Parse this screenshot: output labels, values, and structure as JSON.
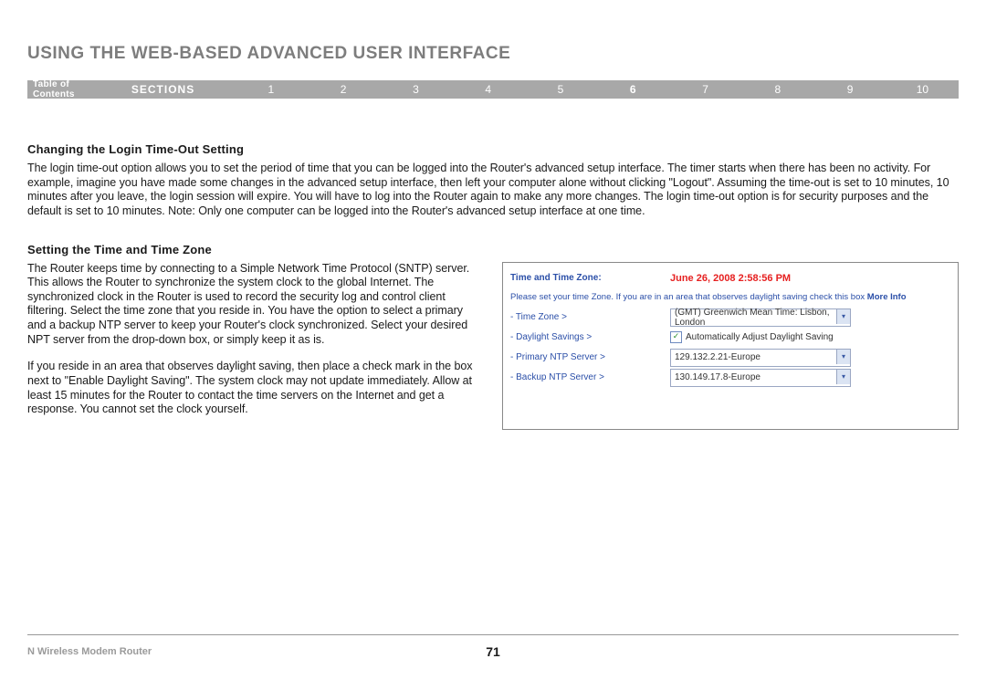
{
  "header": {
    "title": "USING THE WEB-BASED ADVANCED USER INTERFACE"
  },
  "nav": {
    "toc": "Table of Contents",
    "sections_label": "SECTIONS",
    "items": [
      "1",
      "2",
      "3",
      "4",
      "5",
      "6",
      "7",
      "8",
      "9",
      "10"
    ],
    "active": "6"
  },
  "section1": {
    "heading": "Changing the Login Time-Out Setting",
    "body": "The login time-out option allows you to set the period of time that you can be logged into the Router's advanced setup interface. The timer starts when there has been no activity. For example, imagine you have made some changes in the advanced setup interface, then left your computer alone without clicking \"Logout\". Assuming the time-out is set to 10 minutes, 10 minutes after you leave, the login session will expire. You will have to log into the Router again to make any more changes. The login time-out option is for security purposes and the default is set to 10 minutes. Note: Only one computer can be logged into the Router's advanced setup interface at one time."
  },
  "section2": {
    "heading": "Setting the Time and Time Zone",
    "para1": "The Router keeps time by connecting to a Simple Network Time Protocol (SNTP) server. This allows the Router to synchronize the system clock to the global Internet. The synchronized clock in the Router is used to record the security log and control client filtering. Select the time zone that you reside in. You have the option to select a primary and a backup NTP server to keep your Router's clock synchronized. Select your desired NPT server from the drop-down box, or simply keep it as is.",
    "para2": "If you reside in an area that observes daylight saving, then place a check mark in the box next to \"Enable Daylight Saving\". The system clock may not update immediately. Allow at least 15 minutes for the Router to contact the time servers on the Internet and get a response. You cannot set the clock yourself."
  },
  "panel": {
    "title_label": "Time and Time Zone:",
    "datetime": "June 26, 2008   2:58:56 PM",
    "instruction": "Please set your time Zone. If you are in an area that observes daylight saving check this box ",
    "more_info": "More Info",
    "rows": {
      "tz_label": "- Time Zone >",
      "tz_value": "(GMT) Greenwich Mean Time: Lisbon, London",
      "ds_label": "- Daylight Savings >",
      "ds_value": "Automatically Adjust Daylight Saving",
      "pntp_label": "- Primary NTP Server >",
      "pntp_value": "129.132.2.21-Europe",
      "bntp_label": "- Backup NTP Server >",
      "bntp_value": "130.149.17.8-Europe"
    }
  },
  "footer": {
    "product": "N Wireless Modem Router",
    "page": "71"
  }
}
